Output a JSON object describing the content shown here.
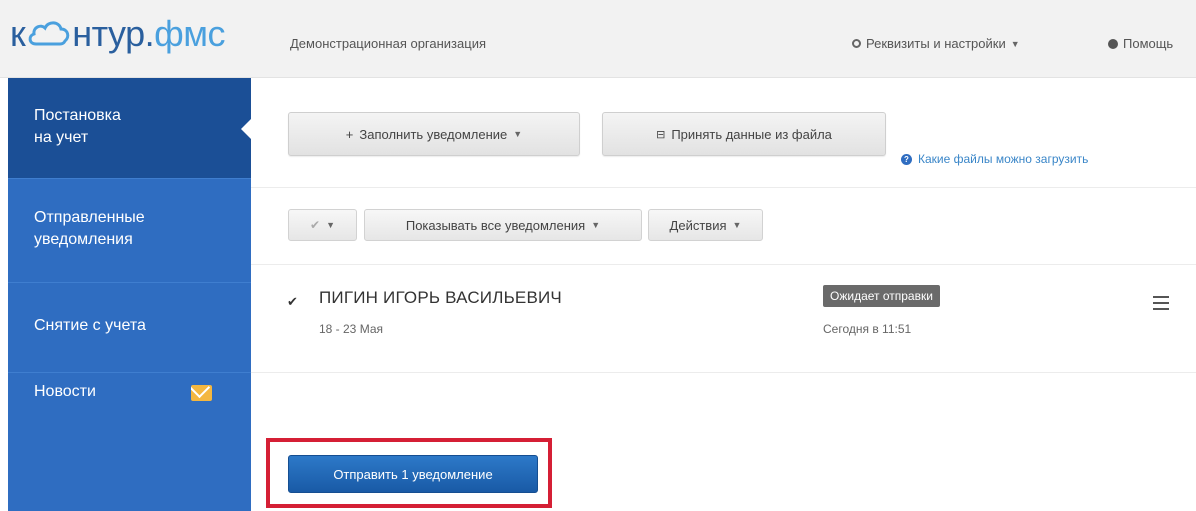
{
  "header": {
    "logo_part1": "к",
    "logo_part2": "нтур.",
    "logo_part3": "фмс",
    "org_name": "Демонстрационная организация",
    "settings_label": "Реквизиты и настройки",
    "help_label": "Помощь"
  },
  "sidebar": {
    "items": [
      {
        "line1": "Постановка",
        "line2": "на учет"
      },
      {
        "line1": "Отправленные",
        "line2": "уведомления"
      },
      {
        "line1": "Снятие с учета"
      },
      {
        "line1": "Новости",
        "icon": "mail-icon"
      }
    ]
  },
  "toolbar": {
    "fill_label": "Заполнить уведомление",
    "import_label": "Принять данные из файла",
    "files_link": "Какие файлы можно загрузить"
  },
  "filters": {
    "show_label": "Показывать все уведомления",
    "actions_label": "Действия"
  },
  "notifications": [
    {
      "name": "ПИГИН ИГОРЬ ВАСИЛЬЕВИЧ",
      "dates": "18 - 23 Мая",
      "status": "Ожидает отправки",
      "time": "Сегодня в 11:51"
    }
  ],
  "send_button": "Отправить 1 уведомление",
  "colors": {
    "sidebar": "#2f6dc1",
    "sidebar_active": "#1b4f96",
    "highlight": "#d51f35",
    "primary": "#195aa6"
  }
}
